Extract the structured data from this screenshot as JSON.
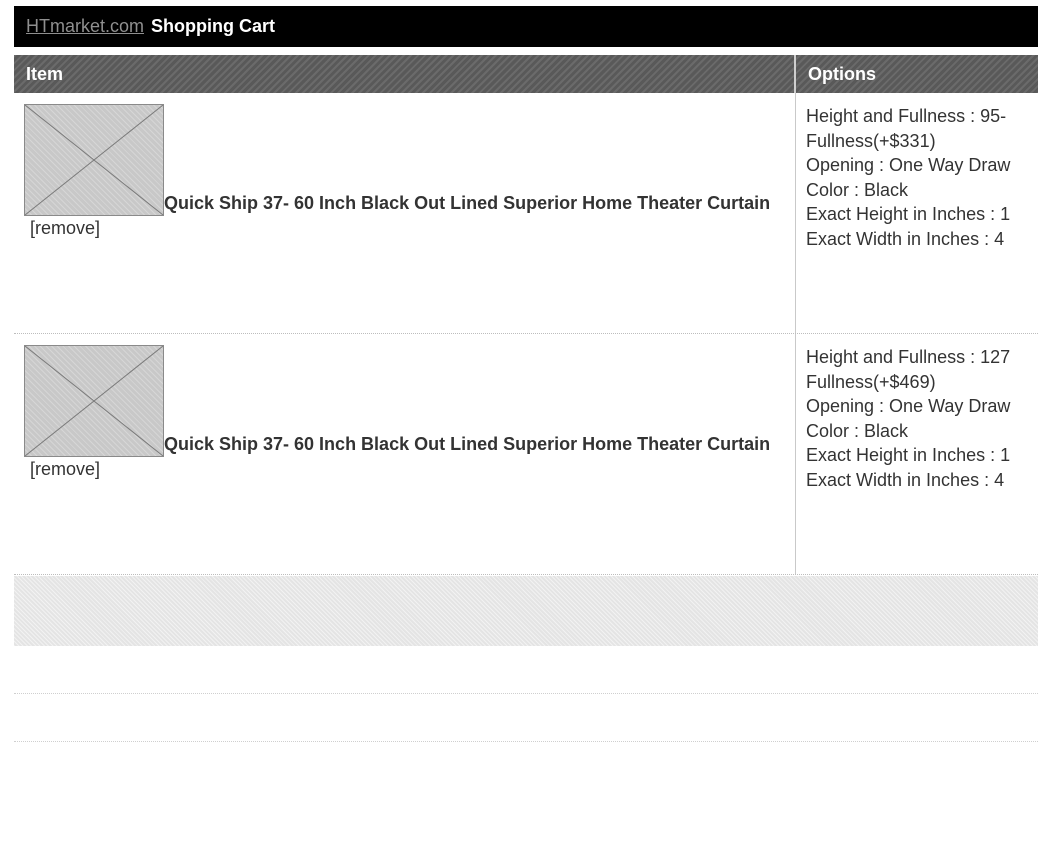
{
  "header": {
    "site_link": "HTmarket.com",
    "title": "Shopping Cart"
  },
  "columns": {
    "item": "Item",
    "options": "Options"
  },
  "items": [
    {
      "name": "Quick Ship 37- 60 Inch Black Out Lined Superior Home Theater Curtain",
      "remove_label": "[remove]",
      "options": [
        "Height and Fullness : 95-",
        "Fullness(+$331)",
        "Opening : One Way Draw",
        "Color : Black",
        "Exact Height in Inches : 1",
        "Exact Width in Inches : 4"
      ]
    },
    {
      "name": "Quick Ship 37- 60 Inch Black Out Lined Superior Home Theater Curtain",
      "remove_label": "[remove]",
      "options": [
        "Height and Fullness : 127",
        "Fullness(+$469)",
        "Opening : One Way Draw",
        "Color : Black",
        "Exact Height in Inches : 1",
        "Exact Width in Inches : 4"
      ]
    }
  ]
}
